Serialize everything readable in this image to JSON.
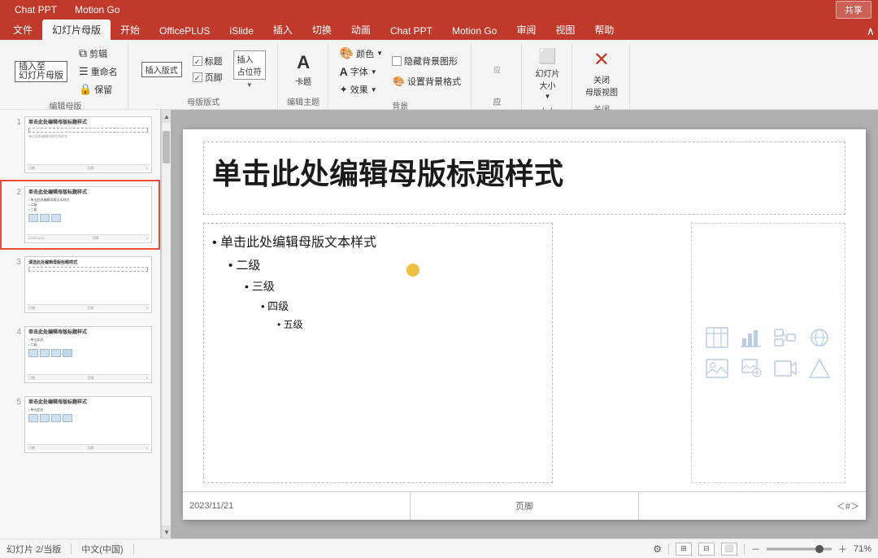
{
  "titlebar": {
    "tabs": [
      "Chat PPT",
      "Motion Go"
    ],
    "share_label": "共享"
  },
  "ribbon_tabs": {
    "items": [
      "文件",
      "幻灯片母版",
      "开始",
      "OfficePLUS",
      "iSlide",
      "插入",
      "切换",
      "动画",
      "Chat PPT",
      "Motion Go",
      "审阅",
      "视图",
      "帮助"
    ]
  },
  "ribbon": {
    "groups": [
      {
        "label": "编辑母版",
        "buttons": [
          {
            "icon": "⊞",
            "label": "插入幻灯片母版"
          },
          {
            "icon": "⊟",
            "label": "插入版式"
          }
        ]
      },
      {
        "label": "母版版式",
        "checks": [
          "标题",
          "页脚"
        ],
        "dropdown": "插入\n占位符"
      },
      {
        "label": "编辑主题",
        "buttons": [
          {
            "icon": "A",
            "label": "卡题"
          }
        ]
      },
      {
        "label": "背景",
        "buttons": [
          {
            "icon": "🎨",
            "label": "颜色"
          },
          {
            "icon": "A",
            "label": "字体"
          },
          {
            "icon": "✦",
            "label": "效果"
          }
        ],
        "checkbox": "隐藏背景图形"
      },
      {
        "label": "大小",
        "buttons": [
          {
            "icon": "⬜",
            "label": "幻灯片\n大小"
          }
        ]
      },
      {
        "label": "关闭",
        "buttons": [
          {
            "icon": "✕",
            "label": "关闭\n母版视图"
          }
        ]
      }
    ]
  },
  "slides": [
    {
      "num": 1,
      "title": "单击此处编辑母版标题样式",
      "has_placeholder": true
    },
    {
      "num": 2,
      "title": "单击此处编辑母版标题样式",
      "selected": true,
      "has_icons": true
    },
    {
      "num": 3,
      "title": "请选此处编辑母版标题样式",
      "has_placeholder": true
    },
    {
      "num": 4,
      "title": "单击此处编辑母版标题样式",
      "has_icons": true,
      "large": true
    },
    {
      "num": 5,
      "title": "单击此处编辑母版标题样式",
      "has_icons": true,
      "large": true
    }
  ],
  "slide_main": {
    "title": "单击此处编辑母版标题样式",
    "bullets": [
      {
        "level": 1,
        "text": "• 单击此处编辑母版文本样式"
      },
      {
        "level": 2,
        "text": "• 二级"
      },
      {
        "level": 3,
        "text": "• 三级"
      },
      {
        "level": 4,
        "text": "• 四级"
      },
      {
        "level": 5,
        "text": "• 五级"
      }
    ],
    "footer_date": "2023/11/21",
    "footer_center": "页脚",
    "footer_page": "＜#＞"
  },
  "status_bar": {
    "slide_info": "幻灯片 2/当版",
    "language": "中文(中国)",
    "zoom": "71%"
  },
  "icons": {
    "table": "⊞",
    "chart": "📊",
    "smartart": "🔷",
    "online": "🌐",
    "picture": "🖼",
    "video": "🎬",
    "clip": "📎",
    "shape": "🔶"
  }
}
